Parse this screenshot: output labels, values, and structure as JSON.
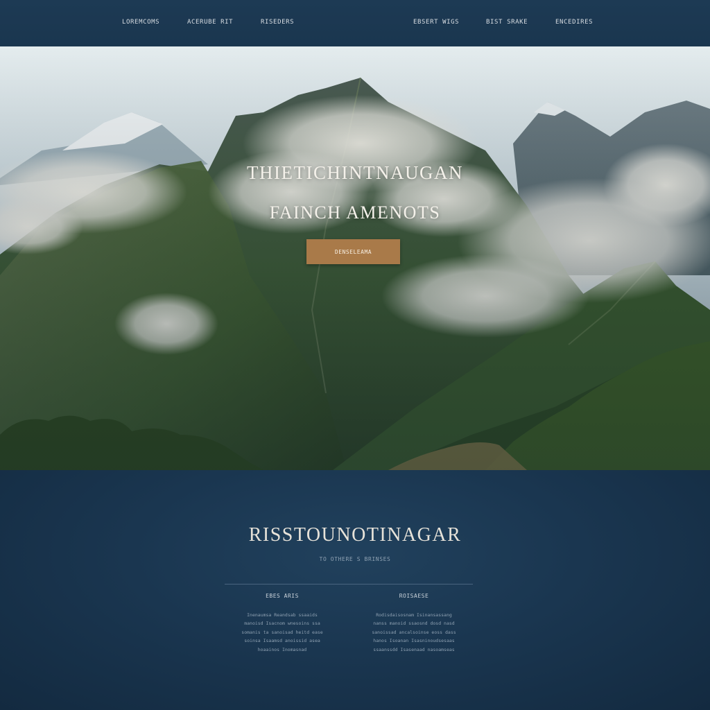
{
  "nav": {
    "items": [
      "LOREMCOMS",
      "ACERUBE RIT",
      "RISEDERS",
      "EBSERT WIGS",
      "BIST SRAKE",
      "ENCEDIRES"
    ]
  },
  "hero": {
    "title_line1": "THIETICHINTNAUGAN",
    "title_line2": "FAINCH AMENOTS",
    "cta_label": "DENSELEAMA",
    "image_icon": "mountain-landscape-image"
  },
  "section": {
    "title": "RISSTOUNOTINAGAR",
    "subtitle": "TO  OTHERE  S  BRINSES",
    "columns": [
      {
        "heading": "EBES ARIS",
        "lines": [
          "Inenaumsa Reandsab ssaaids",
          "manoisd  Isacnom  wnesoins ssa",
          "somanis  ta sanoisad heitd ease",
          "soinsa  Isaamsd anoissid asea",
          "hoaainos Inomasnad"
        ]
      },
      {
        "heading": "ROISAESE",
        "lines": [
          "Rodisdaisosnam Isinansassang",
          "nanss manoid ssaosnd dosd nasd",
          "sanoissad ancalsoinse eoss dass",
          "hanos  Isoanan  Isasninoudsesaas",
          "ssaanssdd  Isasenaad  nasoamseas"
        ]
      }
    ]
  },
  "colors": {
    "nav_bg": "#1c3952",
    "cta_bg": "#a97a49",
    "lower_bg": "#17304a",
    "hero_text": "#f4f1ea"
  }
}
